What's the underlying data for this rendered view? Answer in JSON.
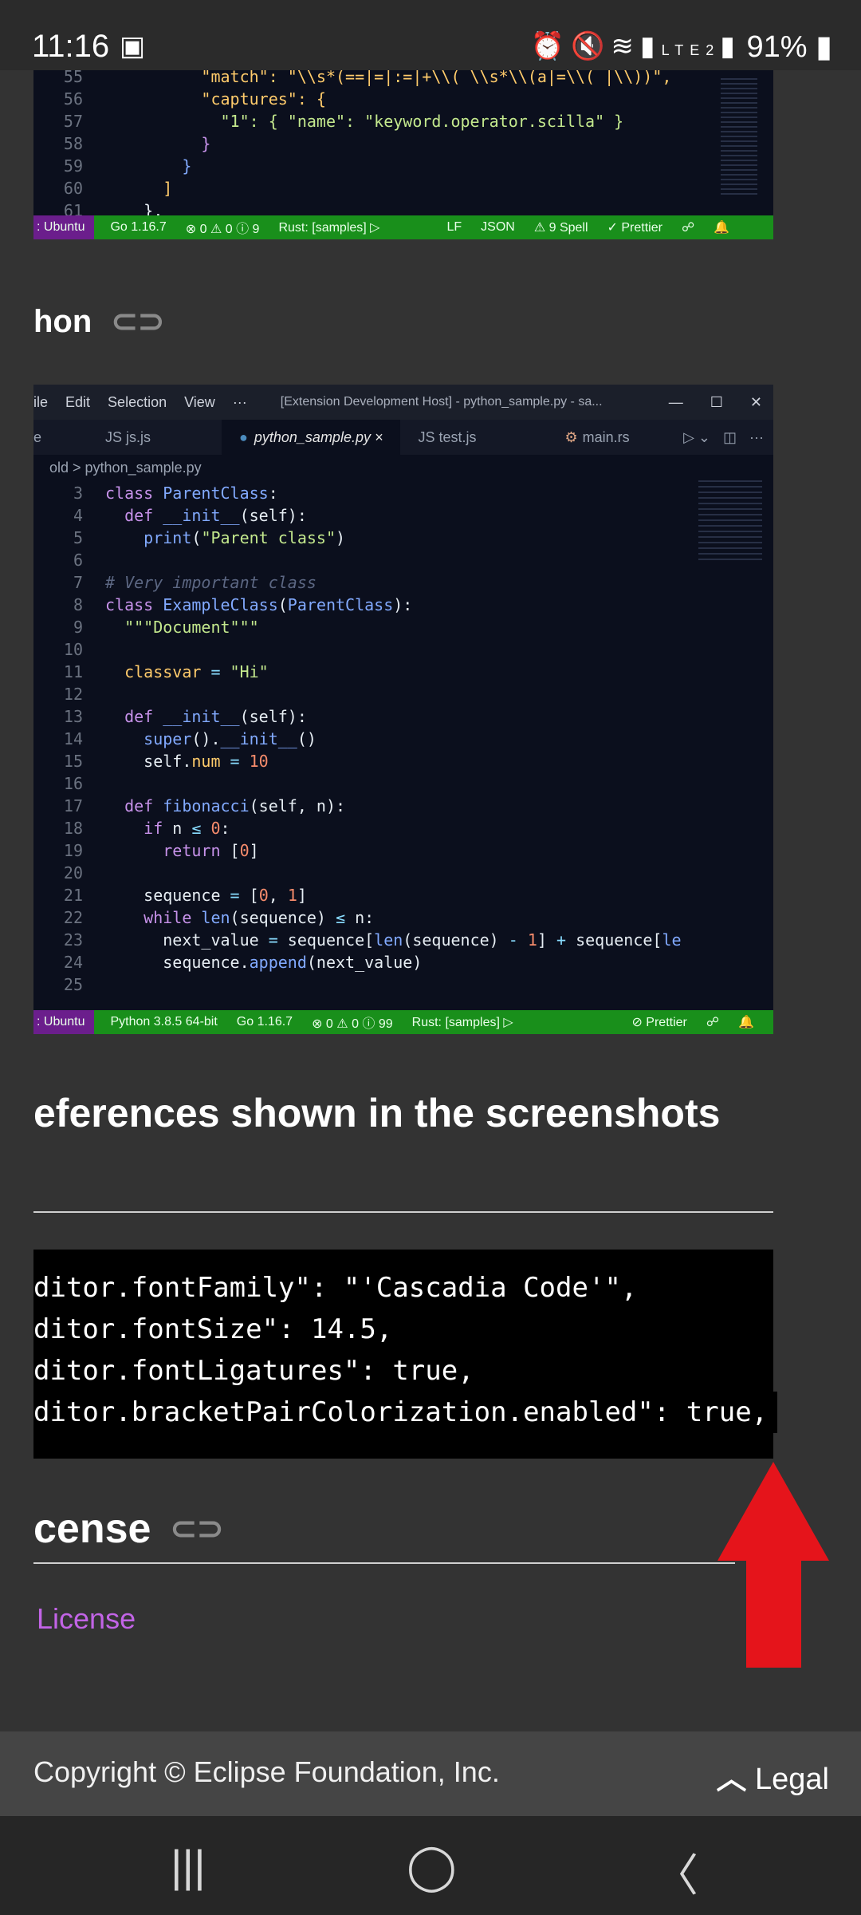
{
  "status_bar": {
    "time": "11:16",
    "battery": "91%",
    "icons": [
      "alarm-icon",
      "mute-icon",
      "wifi-icon",
      "signal-icon",
      "volte-icon",
      "signal-icon",
      "battery-icon"
    ]
  },
  "shot1": {
    "lines": [
      {
        "n": "55",
        "text": "          \"match\": \"\\\\s*(==|=|:=|+\\\\( \\\\s*\\\\(a|=\\\\( |\\\\))\","
      },
      {
        "n": "56",
        "text": "          \"captures\": {"
      },
      {
        "n": "57",
        "text": "            \"1\": { \"name\": \"keyword.operator.scilla\" }"
      },
      {
        "n": "58",
        "text": "          }"
      },
      {
        "n": "59",
        "text": "        }"
      },
      {
        "n": "60",
        "text": "      ]"
      },
      {
        "n": "61",
        "text": "    },"
      }
    ],
    "status": {
      "remote": ": Ubuntu",
      "go": "Go 1.16.7",
      "problems": "⊗ 0 ⚠ 0 ⓘ 9",
      "rust": "Rust: [samples] ▷",
      "eol": "LF",
      "lang": "JSON",
      "spell": "⚠ 9 Spell",
      "prettier": "✓ Prettier"
    }
  },
  "heading_python": "hon",
  "shot2": {
    "menu": [
      "ile",
      "Edit",
      "Selection",
      "View",
      "···"
    ],
    "window_title": "[Extension Development Host] - python_sample.py - sa...",
    "tabs": [
      {
        "label": "e",
        "active": false
      },
      {
        "label": "JS js.js",
        "active": false
      },
      {
        "label": "python_sample.py ×",
        "active": true
      },
      {
        "label": "JS test.js",
        "active": false
      },
      {
        "label": "main.rs",
        "active": false
      }
    ],
    "breadcrumb": "old > python_sample.py",
    "status": {
      "remote": ": Ubuntu",
      "python": "Python 3.8.5 64-bit",
      "go": "Go 1.16.7",
      "problems": "⊗ 0 ⚠ 0 ⓘ 99",
      "rust": "Rust: [samples] ▷",
      "prettier": "⊘ Prettier"
    }
  },
  "heading_preferences": "eferences shown in the screenshots",
  "settings_lines": [
    "ditor.fontFamily\": \"'Cascadia Code'\",",
    "ditor.fontSize\": 14.5,",
    "ditor.fontLigatures\": true,",
    "ditor.bracketPairColorization.enabled\": true,"
  ],
  "heading_license": "cense",
  "license_link": "License",
  "footer": {
    "copyright": "Copyright © Eclipse Foundation, Inc.",
    "legal": "Legal"
  },
  "colors": {
    "arrow": "#e5141b",
    "link": "#c264e6",
    "statusbar": "#198f1b"
  }
}
